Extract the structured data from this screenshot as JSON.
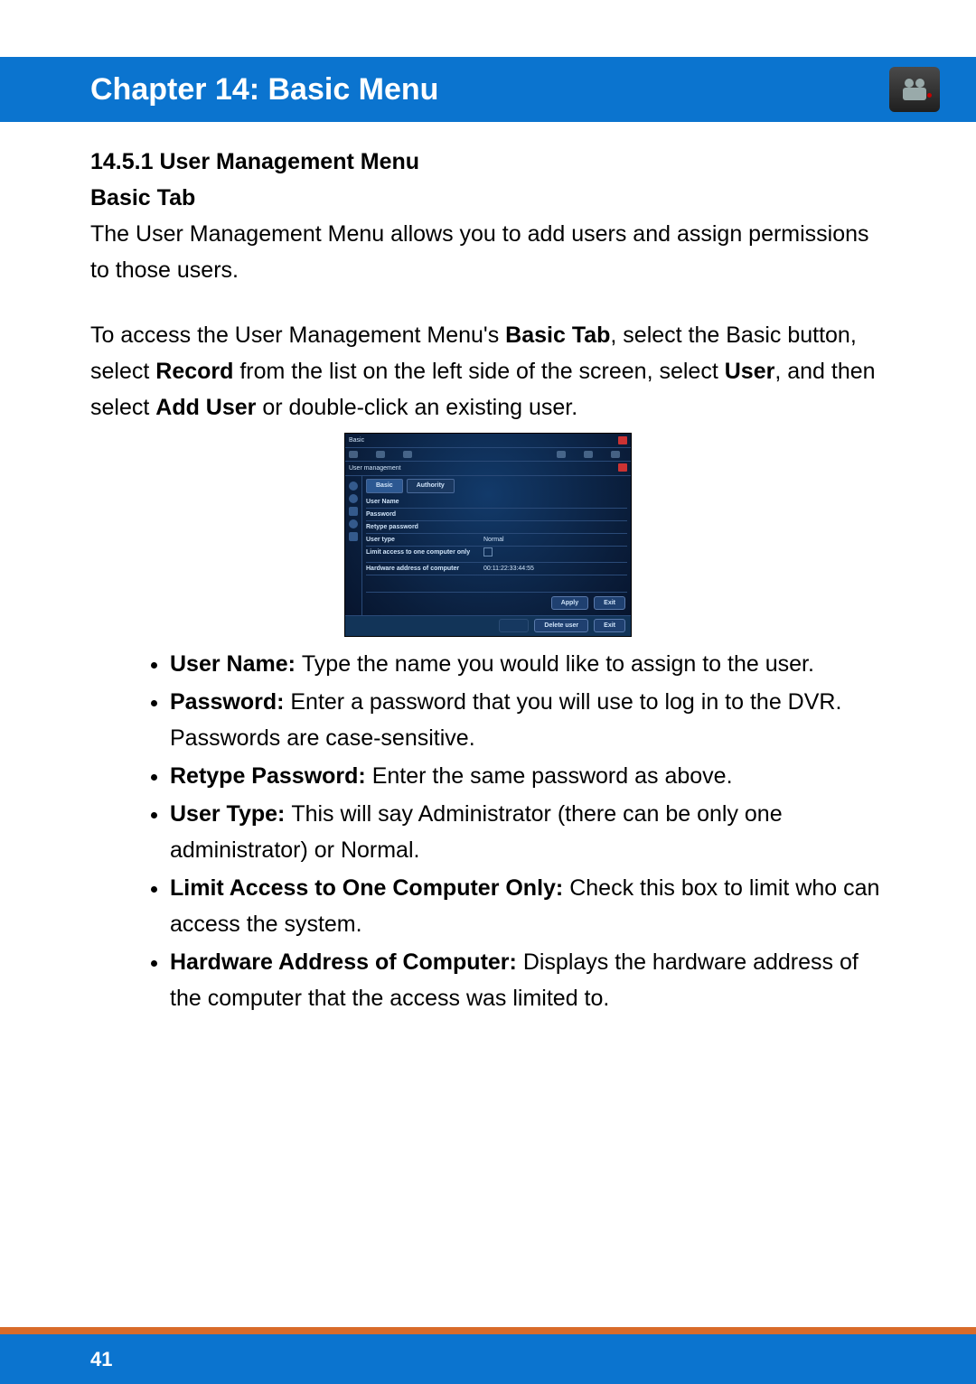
{
  "header": {
    "chapter_title": "Chapter 14: Basic Menu"
  },
  "section": {
    "number_title": "14.5.1 User Management Menu",
    "subtitle": "Basic Tab",
    "intro": "The User Management Menu allows you to add users and assign permissions to those users.",
    "access1a": "To access the User Management Menu's ",
    "access1b_bold": "Basic Tab",
    "access1c": ", select the Basic button, select ",
    "access1d_bold": "Record",
    "access1e": " from the list on the left side of the screen, select ",
    "access1f_bold": "User",
    "access1g": ", and then select ",
    "access1h_bold": "Add User",
    "access1i": " or double-click an existing user."
  },
  "figure": {
    "window_title": "Basic",
    "panel_title": "User management",
    "tabs": {
      "basic": "Basic",
      "authority": "Authority"
    },
    "rows": {
      "username_label": "User Name",
      "password_label": "Password",
      "retype_label": "Retype password",
      "usertype_label": "User type",
      "usertype_value": "Normal",
      "limit_label": "Limit access to one computer only",
      "hw_label": "Hardware address of computer",
      "hw_value": "00:11:22:33:44:55"
    },
    "buttons": {
      "apply": "Apply",
      "exit": "Exit",
      "delete_user": "Delete user",
      "outer_exit": "Exit"
    }
  },
  "bullets": {
    "un_label": "User Name: ",
    "un_text": "Type the name you would like to assign to the user.",
    "pw_label": "Password: ",
    "pw_text": "Enter a password that you will use to log in to the DVR. Passwords are case-sensitive.",
    "rp_label": "Retype Password: ",
    "rp_text": "Enter the same password as above.",
    "ut_label": "User Type: ",
    "ut_text": "This will say Administrator (there can be only one administrator) or Normal.",
    "la_label": "Limit Access to One Computer Only: ",
    "la_text": "Check this box to limit who can access the system.",
    "hw_label": "Hardware Address of Computer: ",
    "hw_text": "Displays the hardware address of the computer that the access was limited to."
  },
  "footer": {
    "page_number": "41"
  }
}
